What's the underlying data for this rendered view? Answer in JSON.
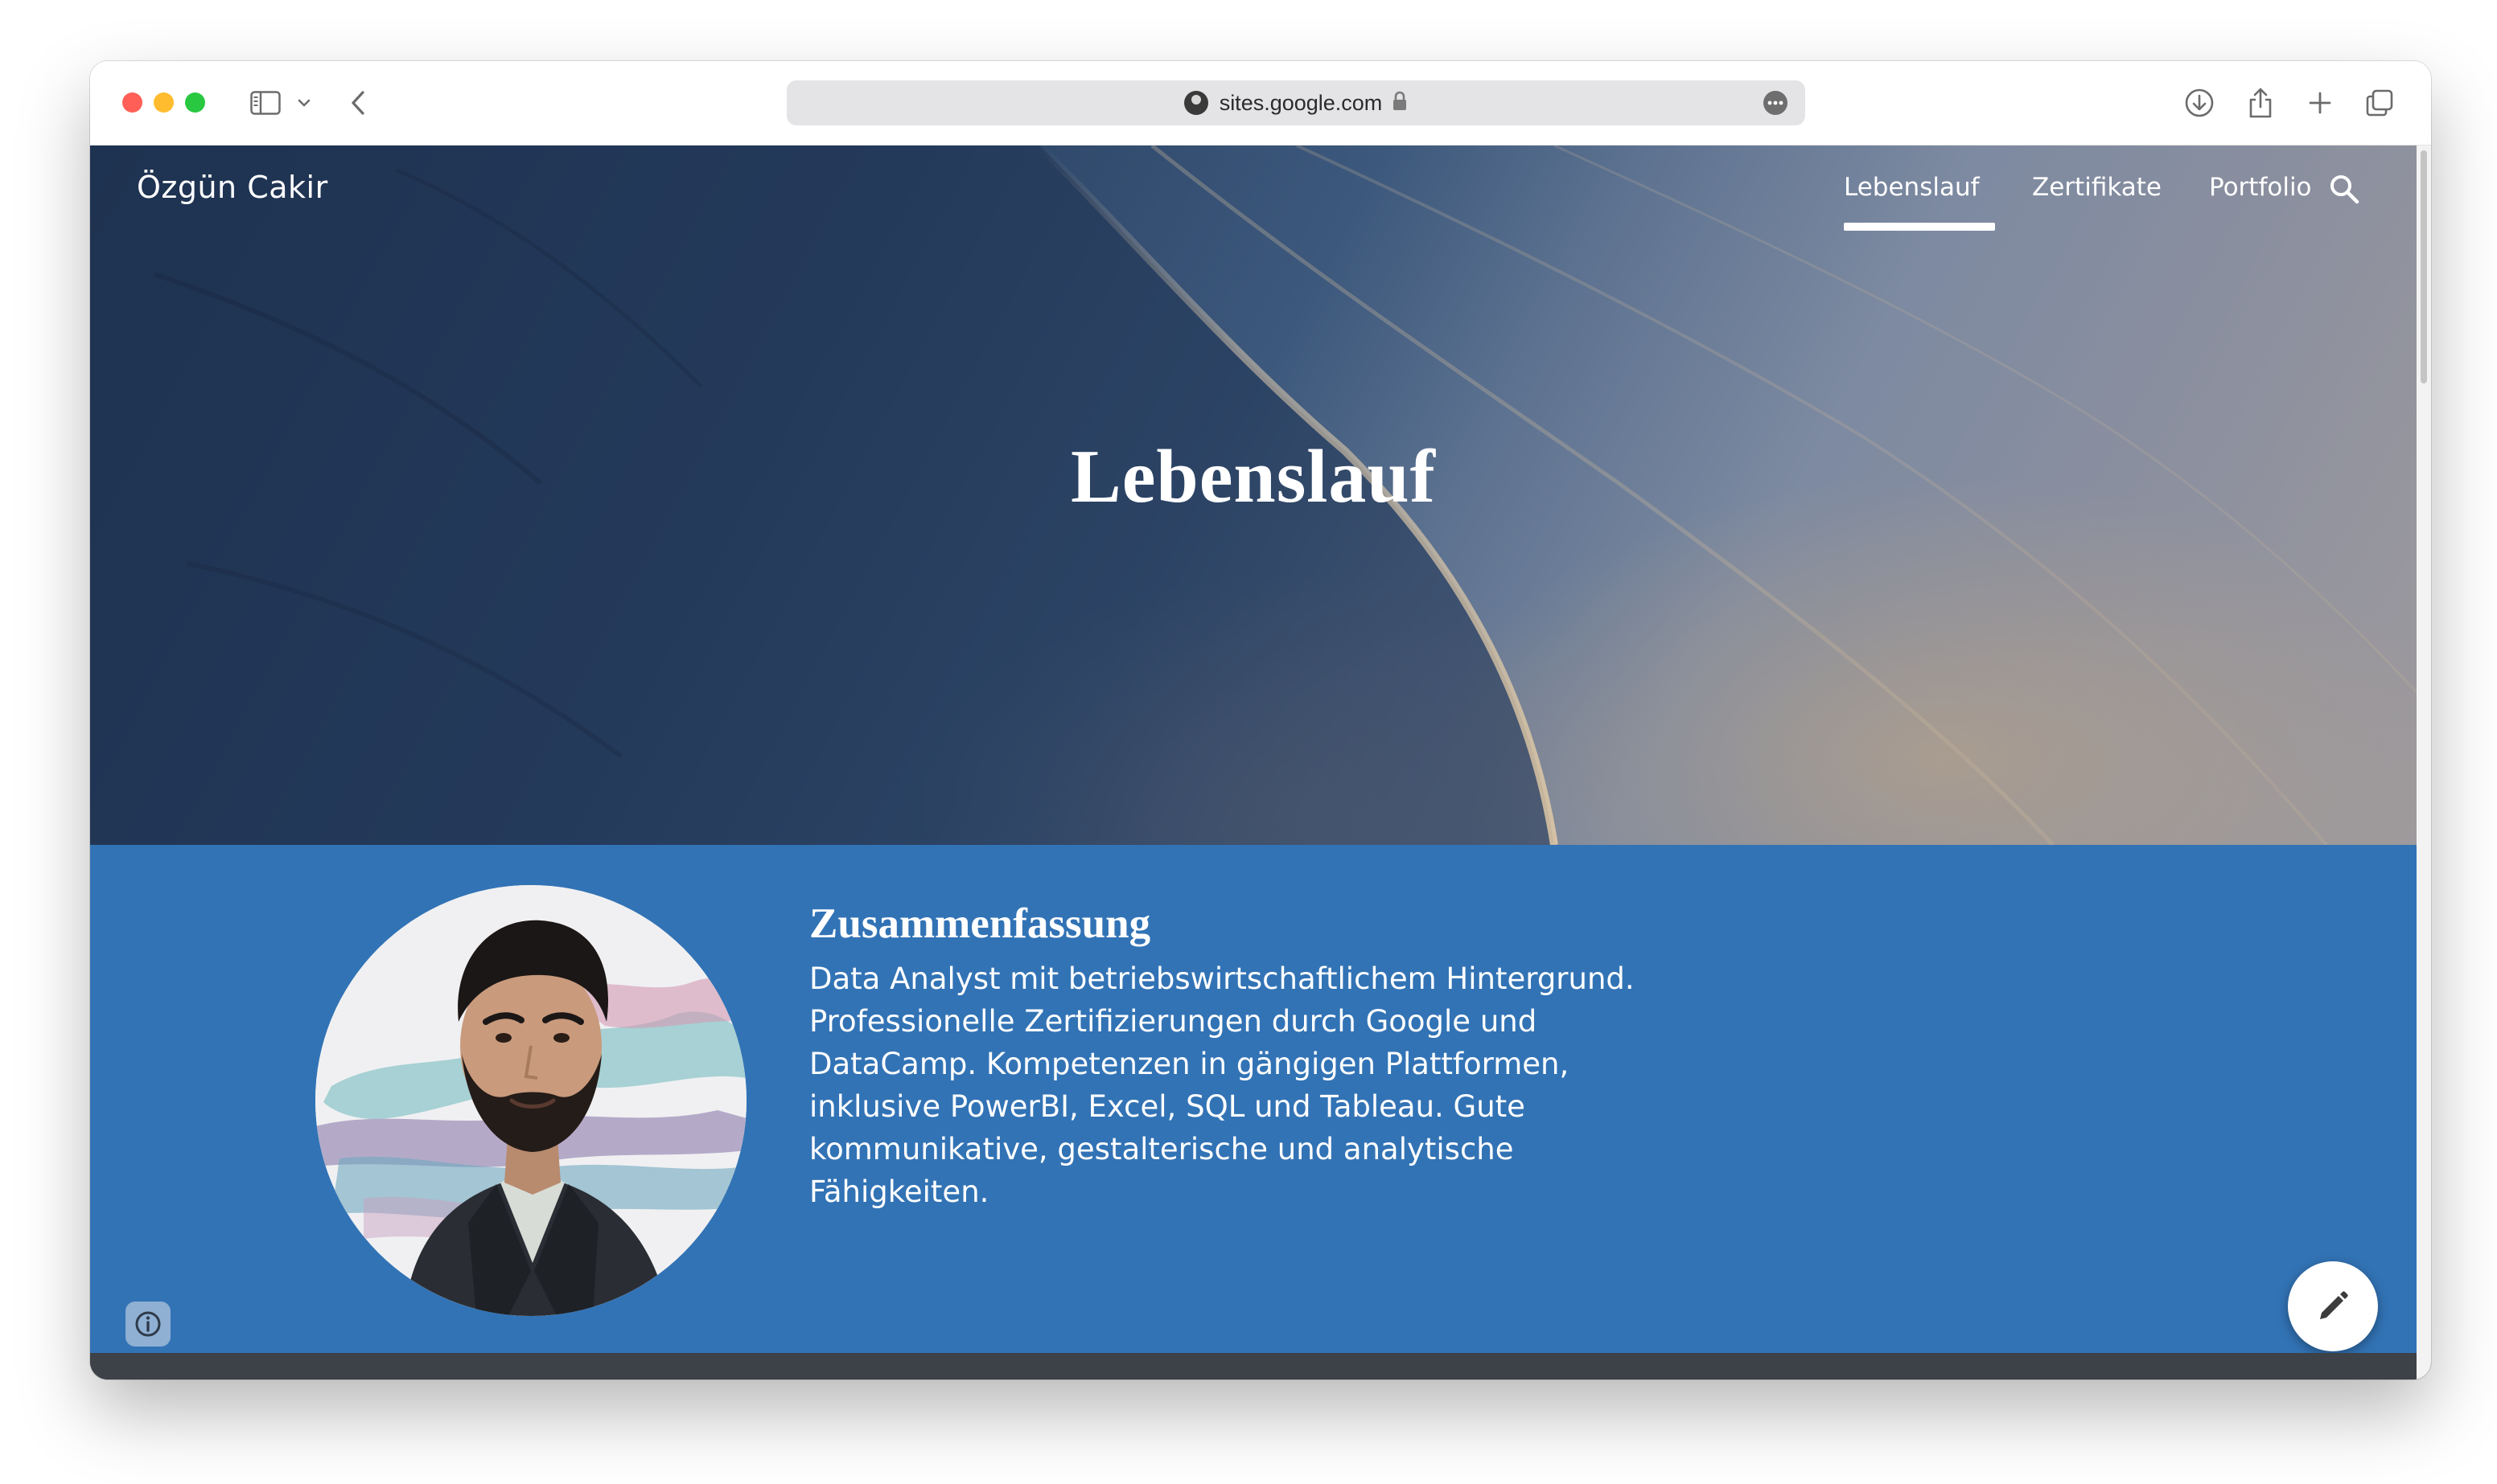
{
  "browser": {
    "url": "sites.google.com",
    "icons": [
      "sidebar-icon",
      "chevron-down-icon",
      "back-arrow-icon",
      "lock-icon",
      "more-icon",
      "download-icon",
      "share-icon",
      "plus-icon",
      "tabs-icon"
    ]
  },
  "site": {
    "title": "Özgün Cakir",
    "nav": {
      "items": [
        {
          "label": "Lebenslauf",
          "active": true
        },
        {
          "label": "Zertifikate",
          "active": false
        },
        {
          "label": "Portfolio",
          "active": false
        }
      ]
    }
  },
  "hero": {
    "title": "Lebenslauf"
  },
  "summary": {
    "heading": "Zusammenfassung",
    "lines": [
      "Data Analyst mit betriebswirtschaftlichem Hintergrund.",
      "Professionelle Zertifizierungen durch Google und",
      "DataCamp. Kompetenzen in gängigen Plattformen,",
      "inklusive PowerBI, Excel, SQL und Tableau. Gute",
      "kommunikative, gestalterische und analytische",
      "Fähigkeiten."
    ]
  },
  "colors": {
    "section_blue": "#3273b5",
    "nav_text": "#ffffff",
    "traffic_red": "#ff5f57",
    "traffic_yellow": "#febc2e",
    "traffic_green": "#28c840"
  }
}
